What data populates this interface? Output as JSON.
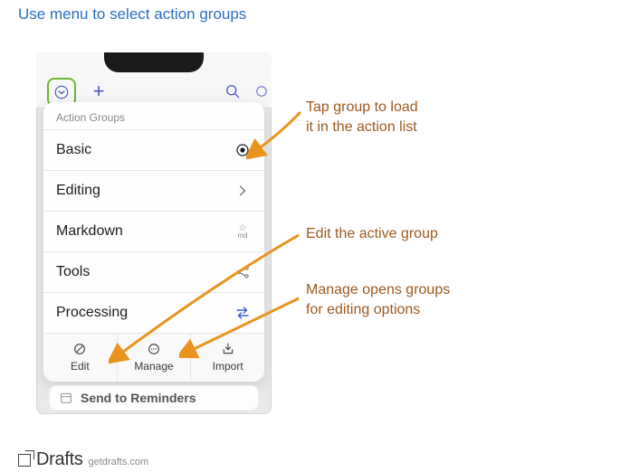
{
  "title": "Use menu to select action groups",
  "toolbar": {
    "menu_icon": "chevron-circle-down",
    "plus_label": "+",
    "search_icon": "magnifier"
  },
  "sheet": {
    "header": "Action Groups",
    "items": [
      {
        "label": "Basic",
        "icon": "target"
      },
      {
        "label": "Editing",
        "icon": "chevron-right"
      },
      {
        "label": "Markdown",
        "icon": "md-badge"
      },
      {
        "label": "Tools",
        "icon": "share"
      },
      {
        "label": "Processing",
        "icon": "swap"
      }
    ],
    "bottom": {
      "edit": "Edit",
      "manage": "Manage",
      "import": "Import"
    }
  },
  "belowRow": "Send to Reminders",
  "annotations": {
    "a1_line1": "Tap group to load",
    "a1_line2": "it in the action list",
    "a2": "Edit the active group",
    "a3_line1": "Manage opens groups",
    "a3_line2": "for editing options"
  },
  "footer": {
    "logo_text": "Drafts",
    "url": "getdrafts.com"
  }
}
